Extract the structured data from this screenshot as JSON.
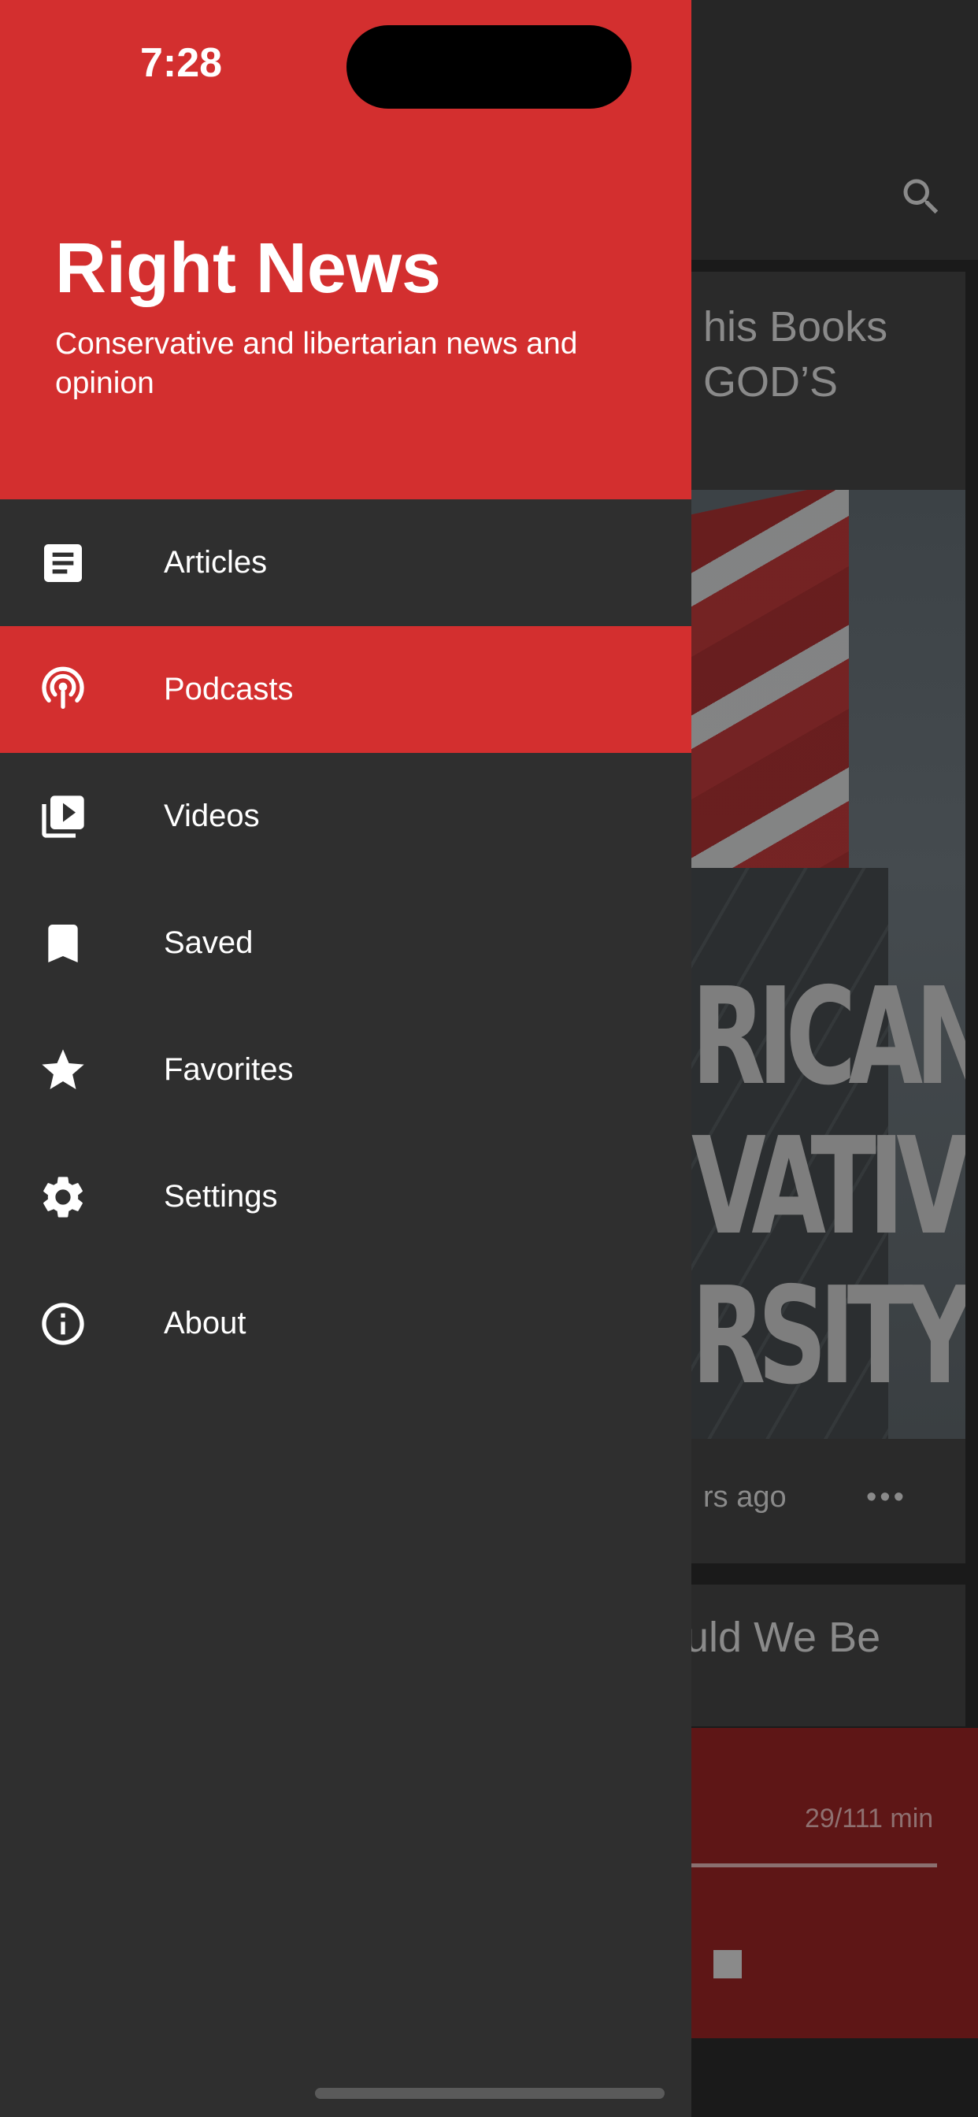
{
  "status_bar": {
    "time": "7:28"
  },
  "drawer": {
    "title": "Right News",
    "subtitle": "Conservative and libertarian news and opinion",
    "items": [
      {
        "label": "Articles",
        "icon": "article-icon",
        "active": false
      },
      {
        "label": "Podcasts",
        "icon": "podcast-icon",
        "active": true
      },
      {
        "label": "Videos",
        "icon": "video-library-icon",
        "active": false
      },
      {
        "label": "Saved",
        "icon": "bookmark-icon",
        "active": false
      },
      {
        "label": "Favorites",
        "icon": "star-icon",
        "active": false
      },
      {
        "label": "Settings",
        "icon": "gear-icon",
        "active": false
      },
      {
        "label": "About",
        "icon": "info-icon",
        "active": false
      }
    ]
  },
  "background": {
    "card1_title_line1": "his Books",
    "card1_title_line2": "GOD’S",
    "image_text_line1": "RICAN",
    "image_text_line2": "VATIVE",
    "image_text_line3": "RSITY",
    "card1_meta": "rs ago",
    "card1_more": "•••",
    "card2_title": "uld We Be",
    "player_time": "29/111 min"
  },
  "colors": {
    "accent": "#d32f2f",
    "drawer_bg": "#2f2f2f"
  }
}
